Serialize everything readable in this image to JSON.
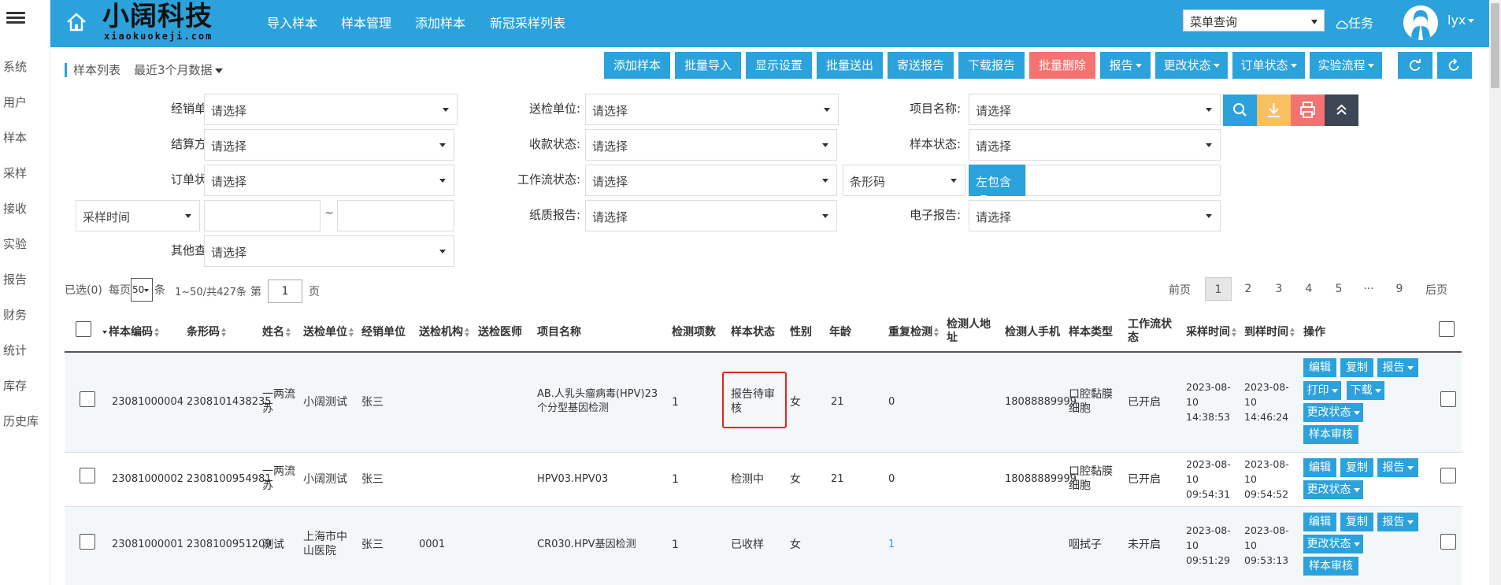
{
  "sidebar": {
    "items": [
      "系统",
      "用户",
      "样本",
      "采样",
      "接收",
      "实验",
      "报告",
      "财务",
      "统计",
      "库存",
      "历史库"
    ]
  },
  "header": {
    "logo_cn": "小阔科技",
    "logo_en": "xiaokuokeji.com",
    "nav": [
      "导入样本",
      "样本管理",
      "添加样本",
      "新冠采样列表"
    ],
    "menu_search": "菜单查询",
    "task_label": "任务",
    "user_name": "lyx"
  },
  "toolbar": {
    "list_title": "样本列表",
    "range": "最近3个月数据",
    "buttons": [
      "添加样本",
      "批量导入",
      "显示设置",
      "批量送出",
      "寄送报告",
      "下载报告",
      "批量删除",
      "报告",
      "更改状态",
      "订单状态",
      "实验流程"
    ]
  },
  "filters": {
    "dealer_label": "经销单位:",
    "sender_label": "送检单位:",
    "project_label": "项目名称:",
    "settlement_label": "结算方式:",
    "payment_label": "收款状态:",
    "sample_status_label": "样本状态:",
    "order_status_label": "订单状态:",
    "workflow_label": "工作流状态:",
    "barcode_select": "条形码",
    "contain_select": "左包含",
    "time_select": "采样时间",
    "time_sep": "~",
    "paper_label": "纸质报告:",
    "electronic_label": "电子报告:",
    "other_label": "其他查询:",
    "placeholder": "请选择"
  },
  "pagination": {
    "selected": "已选(0)",
    "per_page_prefix": "每页",
    "per_page": "50",
    "per_page_suffix": "条",
    "range": "1~50/共427条",
    "page_prefix": "第",
    "page_value": "1",
    "page_suffix": "页",
    "prev": "前页",
    "next": "后页",
    "pages": [
      "1",
      "2",
      "3",
      "4",
      "5",
      "···",
      "9"
    ]
  },
  "table": {
    "headers": {
      "sample_no": "样本编码",
      "barcode": "条形码",
      "name": "姓名",
      "sender": "送检单位",
      "dealer": "经销单位",
      "institution": "送检机构",
      "doctor": "送检医师",
      "project": "项目名称",
      "items": "检测项数",
      "status": "样本状态",
      "gender": "性别",
      "age": "年龄",
      "retest": "重复检测",
      "address": "检测人地址",
      "phone": "检测人手机",
      "sample_type": "样本类型",
      "workflow": "工作流状态",
      "sample_time": "采样时间",
      "receive_time": "到样时间",
      "actions": "操作"
    },
    "rows": [
      {
        "sample_no": "23081000004",
        "barcode": "2308101438235",
        "name": "一两流苏",
        "sender": "小阔测试",
        "dealer": "张三",
        "institution": "",
        "project": "AB.人乳头瘤病毒(HPV)23 个分型基因检测",
        "items": "1",
        "status": "报告待审核",
        "gender": "女",
        "age": "21",
        "retest": "0",
        "phone": "18088889999",
        "sample_type": "口腔黏膜细胞",
        "workflow": "已开启",
        "sample_time_date": "2023-08-10",
        "sample_time_clock": "14:38:53",
        "receive_time_date": "2023-08-10",
        "receive_time_clock": "14:46:24",
        "actions": [
          "编辑",
          "复制",
          "报告",
          "打印",
          "下载",
          "更改状态",
          "样本审核"
        ]
      },
      {
        "sample_no": "23081000002",
        "barcode": "2308100954981",
        "name": "一两流苏",
        "sender": "小阔测试",
        "dealer": "张三",
        "institution": "",
        "project": "HPV03.HPV03",
        "items": "1",
        "status": "检测中",
        "gender": "女",
        "age": "21",
        "retest": "0",
        "phone": "18088889999",
        "sample_type": "口腔黏膜细胞",
        "workflow": "已开启",
        "sample_time_date": "2023-08-10",
        "sample_time_clock": "09:54:31",
        "receive_time_date": "2023-08-10",
        "receive_time_clock": "09:54:52",
        "actions": [
          "编辑",
          "复制",
          "报告",
          "更改状态"
        ]
      },
      {
        "sample_no": "23081000001",
        "barcode": "2308100951209",
        "name": "测试",
        "sender": "上海市中山医院",
        "dealer": "张三",
        "institution": "0001",
        "project": "CR030.HPV基因检测",
        "items": "1",
        "status": "已收样",
        "gender": "女",
        "age": "",
        "retest": "1",
        "phone": "",
        "sample_type": "咽拭子",
        "workflow": "未开启",
        "sample_time_date": "2023-08-10",
        "sample_time_clock": "09:51:29",
        "receive_time_date": "2023-08-10",
        "receive_time_clock": "09:53:13",
        "actions": [
          "编辑",
          "复制",
          "报告",
          "更改状态",
          "样本审核"
        ]
      }
    ]
  },
  "colors": {
    "primary": "#2ba2dc",
    "danger": "#f57272",
    "search_btn": "#2ba2dc",
    "download_btn": "#f9c061",
    "print_btn": "#f57272",
    "collapse_btn": "#3c4654",
    "highlight": "#e0261a"
  }
}
